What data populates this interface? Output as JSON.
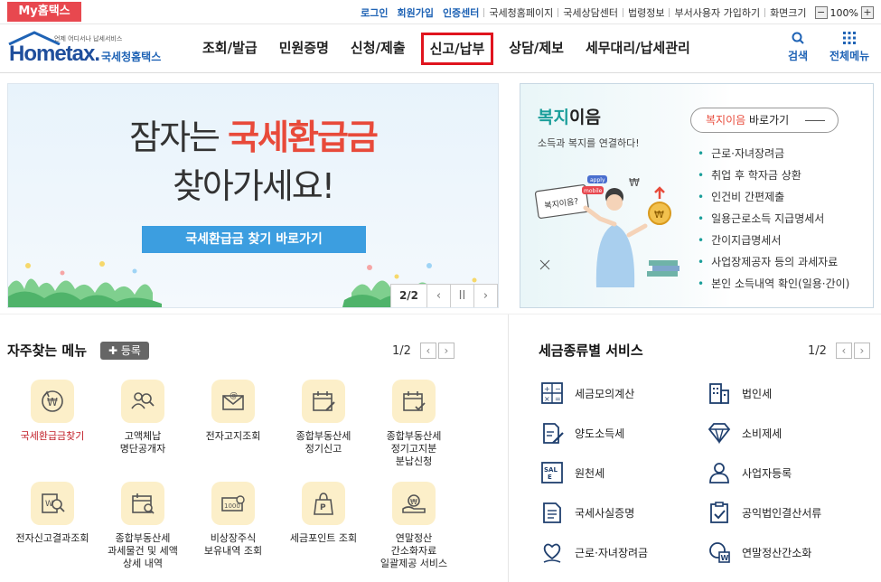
{
  "topbar": {
    "my_tab": "My홈택스",
    "links": [
      "로그인",
      "회원가입",
      "인증센터"
    ],
    "plain_links": [
      "국세청홈페이지",
      "국세상담센터",
      "법령정보",
      "부서사용자 가입하기",
      "화면크기"
    ],
    "zoom": {
      "minus": "−",
      "value": "100%",
      "plus": "+"
    }
  },
  "header": {
    "logo_small": "언제 어디서나 납세서비스",
    "logo_main": "Hometax.",
    "logo_sub": "국세청홈택스",
    "nav": [
      "조회/발급",
      "민원증명",
      "신청/제출",
      "신고/납부",
      "상담/제보",
      "세무대리/납세관리"
    ],
    "active_nav": "신고/납부",
    "search": "검색",
    "all_menu": "전체메뉴"
  },
  "banner": {
    "line1_pre": "잠자는 ",
    "line1_hl": "국세환급금",
    "line2": "찾아가세요!",
    "button": "국세환급금 찾기 바로가기",
    "page": "2/2",
    "prev": "‹",
    "pause": "II",
    "next": "›"
  },
  "welfare": {
    "title_acc": "복지",
    "title_rest": "이음",
    "subtitle": "소득과 복지를 연결하다!",
    "go_acc": "복지이음",
    "go_rest": " 바로가기",
    "items": [
      "근로·자녀장려금",
      "취업 후 학자금 상환",
      "인건비 간편제출",
      "일용근로소득 지급명세서",
      "간이지급명세서",
      "사업장제공자 등의 과세자료",
      "본인 소득내역 확인(일용·간이)"
    ],
    "illu_labels": {
      "board": "복지이음?",
      "tag1": "apply",
      "tag2": "mobile"
    }
  },
  "favorites": {
    "title": "자주찾는 메뉴",
    "register": "등록",
    "page": "1/2",
    "items": [
      {
        "label": "국세환급금찾기",
        "icon": "refund-icon"
      },
      {
        "label": "고액체납\n명단공개자",
        "icon": "people-search-icon"
      },
      {
        "label": "전자고지조회",
        "icon": "email-notice-icon"
      },
      {
        "label": "종합부동산세\n정기신고",
        "icon": "calendar-edit-icon"
      },
      {
        "label": "종합부동산세\n정기고지분\n분납신청",
        "icon": "calendar-check-icon"
      },
      {
        "label": "전자신고결과조회",
        "icon": "document-search-icon"
      },
      {
        "label": "종합부동산세\n과세물건 및 세액\n상세 내역",
        "icon": "calendar-search-icon"
      },
      {
        "label": "비상장주식\n보유내역 조회",
        "icon": "stock-certificate-icon"
      },
      {
        "label": "세금포인트 조회",
        "icon": "tax-point-bag-icon"
      },
      {
        "label": "연말정산\n간소화자료\n일괄제공 서비스",
        "icon": "bulk-provide-icon"
      }
    ]
  },
  "tax_services": {
    "title": "세금종류별 서비스",
    "page": "1/2",
    "items": [
      {
        "label": "세금모의계산",
        "icon": "calculator-icon"
      },
      {
        "label": "법인세",
        "icon": "building-icon"
      },
      {
        "label": "양도소득세",
        "icon": "document-edit-icon"
      },
      {
        "label": "소비제세",
        "icon": "diamond-icon"
      },
      {
        "label": "원천세",
        "icon": "sale-tag-icon"
      },
      {
        "label": "사업자등록",
        "icon": "person-icon"
      },
      {
        "label": "국세사실증명",
        "icon": "certificate-icon"
      },
      {
        "label": "공익법인결산서류",
        "icon": "clipboard-check-icon"
      },
      {
        "label": "근로·자녀장려금",
        "icon": "heart-hand-icon"
      },
      {
        "label": "연말정산간소화",
        "icon": "speech-w-icon"
      }
    ]
  }
}
